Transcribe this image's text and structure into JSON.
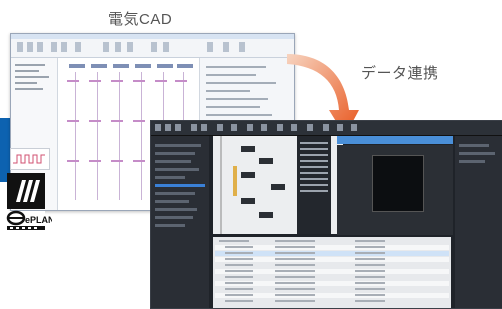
{
  "captions": {
    "cad_label": "電気CAD",
    "link_label": "データ連携"
  },
  "logo": {
    "text": "ePLAN"
  },
  "colors": {
    "accent_blue": "#0d62b0",
    "arrow_orange": "#e8551c",
    "studio_dark": "#1f2329",
    "studio_highlight": "#4a8fd8"
  },
  "icons": {
    "arrow": "curved-arrow-icon",
    "logo": "eplan-logo"
  }
}
